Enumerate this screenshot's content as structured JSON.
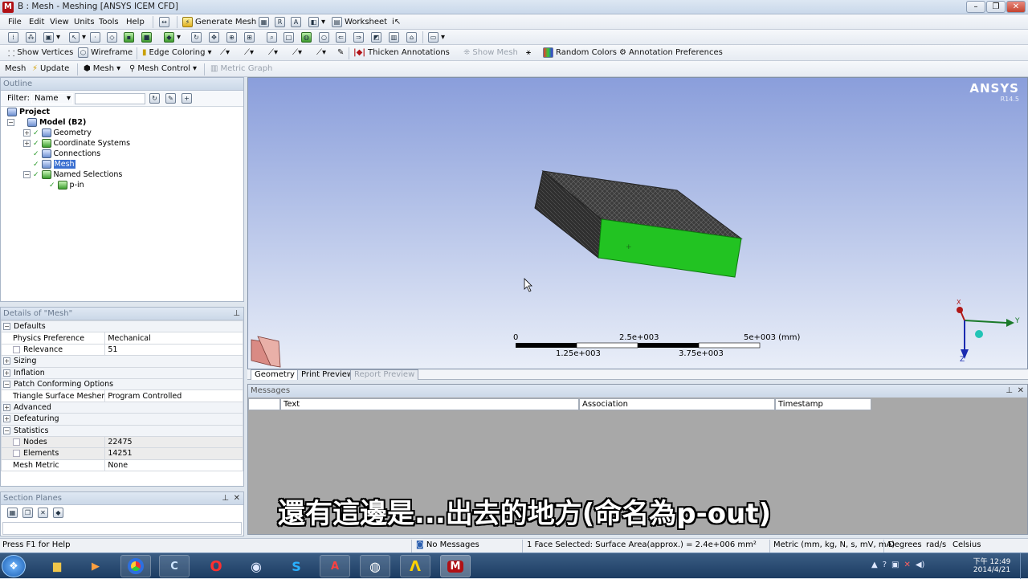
{
  "window": {
    "title": "B : Mesh - Meshing [ANSYS ICEM CFD]",
    "app_icon": "M",
    "btn_minimize": "–",
    "btn_restore": "❐",
    "btn_close": "✕"
  },
  "menu": [
    "File",
    "Edit",
    "View",
    "Units",
    "Tools",
    "Help"
  ],
  "toolbar1": {
    "generate_mesh": "Generate Mesh",
    "worksheet": "Worksheet"
  },
  "toolbar3": {
    "show_vertices": "Show Vertices",
    "wireframe": "Wireframe",
    "edge_coloring": "Edge Coloring",
    "thicken_annotations": "Thicken Annotations",
    "show_mesh": "Show Mesh",
    "random_colors": "Random Colors",
    "annotation_preferences": "Annotation Preferences"
  },
  "toolbar4": {
    "mesh": "Mesh",
    "update": "Update",
    "mesh_menu": "Mesh",
    "mesh_control": "Mesh Control",
    "metric_graph": "Metric Graph"
  },
  "outline": {
    "title": "Outline",
    "filter_label": "Filter:",
    "filter_value": "Name",
    "tree": [
      "Project",
      "Model (B2)",
      "Geometry",
      "Coordinate Systems",
      "Connections",
      "Mesh",
      "Named Selections",
      "p-in"
    ]
  },
  "details": {
    "title": "Details of \"Mesh\"",
    "rows": [
      {
        "k": "Defaults",
        "v": "",
        "type": "group",
        "exp": "−"
      },
      {
        "k": "Physics Preference",
        "v": "Mechanical",
        "type": "prop"
      },
      {
        "k": "Relevance",
        "v": "51",
        "type": "propchk"
      },
      {
        "k": "Sizing",
        "v": "",
        "type": "group",
        "exp": "+"
      },
      {
        "k": "Inflation",
        "v": "",
        "type": "group",
        "exp": "+"
      },
      {
        "k": "Patch Conforming Options",
        "v": "",
        "type": "group",
        "exp": "−"
      },
      {
        "k": "Triangle Surface Mesher",
        "v": "Program Controlled",
        "type": "prop"
      },
      {
        "k": "Advanced",
        "v": "",
        "type": "group",
        "exp": "+"
      },
      {
        "k": "Defeaturing",
        "v": "",
        "type": "group",
        "exp": "+"
      },
      {
        "k": "Statistics",
        "v": "",
        "type": "group",
        "exp": "−"
      },
      {
        "k": "Nodes",
        "v": "22475",
        "type": "shadechk"
      },
      {
        "k": "Elements",
        "v": "14251",
        "type": "shadechk"
      },
      {
        "k": "Mesh Metric",
        "v": "None",
        "type": "prop"
      }
    ]
  },
  "section_planes": {
    "title": "Section Planes"
  },
  "viewport": {
    "brand": "ANSYS",
    "version": "R14.5",
    "scale_top": [
      "0",
      "2.5e+003",
      "5e+003 (mm)"
    ],
    "scale_bottom": [
      "1.25e+003",
      "3.75e+003"
    ],
    "axis_y": "Y",
    "axis_z": "Z",
    "axis_x": "X"
  },
  "view_tabs": [
    "Geometry",
    "Print Preview",
    "Report Preview"
  ],
  "messages": {
    "title": "Messages",
    "columns": [
      "Text",
      "Association",
      "Timestamp"
    ]
  },
  "status": {
    "help": "Press F1 for Help",
    "messages": "No Messages",
    "selection": "1 Face Selected: Surface Area(approx.) = 2.4e+006 mm²",
    "units": "Metric (mm, kg, N, s, mV, mA)",
    "degrees": "Degrees",
    "rads": "rad/s",
    "temp": "Celsius"
  },
  "subtitle": "還有這邊是...出去的地方(命名為p-out)",
  "taskbar": {
    "time": "下午 12:49",
    "date": "2014/4/21",
    "icons": [
      "start-orb",
      "explorer",
      "media-player",
      "chrome",
      "ccleaner",
      "opera",
      "globe",
      "skype",
      "acrobat",
      "obs",
      "ansys-workbench",
      "icem-meshing"
    ]
  },
  "colors": {
    "mesh_green": "#22c322",
    "mesh_dark": "#3a3a3a",
    "accent": "#1c3c62"
  }
}
